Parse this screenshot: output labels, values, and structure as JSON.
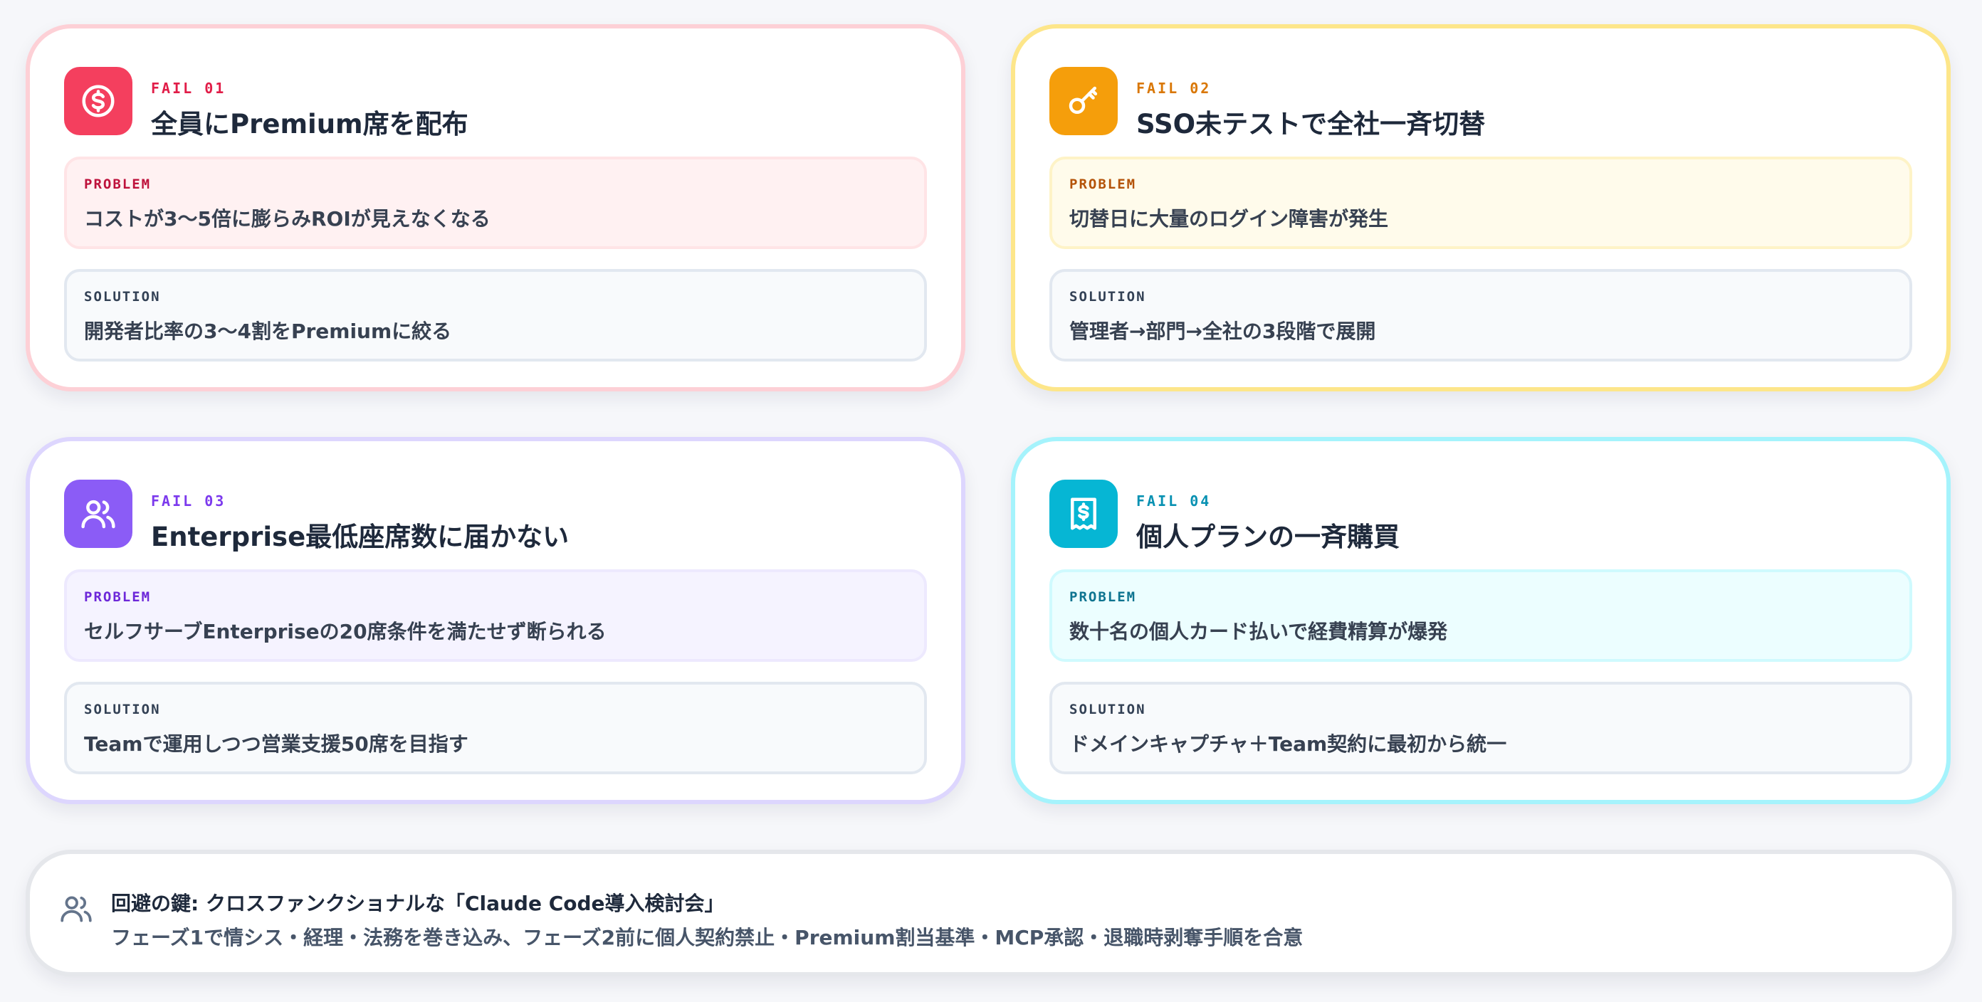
{
  "cards": [
    {
      "tag": "FAIL 01",
      "title": "全員にPremium席を配布",
      "icon": "dollar-circle-icon",
      "accent": "#f43f5e",
      "problem_label": "PROBLEM",
      "problem": "コストが3〜5倍に膨らみROIが見えなくなる",
      "solution_label": "SOLUTION",
      "solution": "開発者比率の3〜4割をPremiumに絞る"
    },
    {
      "tag": "FAIL 02",
      "title": "SSO未テストで全社一斉切替",
      "icon": "key-icon",
      "accent": "#f59e0b",
      "problem_label": "PROBLEM",
      "problem": "切替日に大量のログイン障害が発生",
      "solution_label": "SOLUTION",
      "solution": "管理者→部門→全社の3段階で展開"
    },
    {
      "tag": "FAIL 03",
      "title": "Enterprise最低座席数に届かない",
      "icon": "users-icon",
      "accent": "#8b5cf6",
      "problem_label": "PROBLEM",
      "problem": "セルフサーブEnterpriseの20席条件を満たせず断られる",
      "solution_label": "SOLUTION",
      "solution": "Teamで運用しつつ営業支援50席を目指す"
    },
    {
      "tag": "FAIL 04",
      "title": "個人プランの一斉購買",
      "icon": "receipt-icon",
      "accent": "#06b6d4",
      "problem_label": "PROBLEM",
      "problem": "数十名の個人カード払いで経費精算が爆発",
      "solution_label": "SOLUTION",
      "solution": "ドメインキャプチャ＋Team契約に最初から統一"
    }
  ],
  "footer": {
    "icon": "users-icon",
    "title": "回避の鍵: クロスファンクショナルな「Claude Code導入検討会」",
    "text": "フェーズ1で情シス・経理・法務を巻き込み、フェーズ2前に個人契約禁止・Premium割当基準・MCP承認・退職時剥奪手順を合意"
  }
}
